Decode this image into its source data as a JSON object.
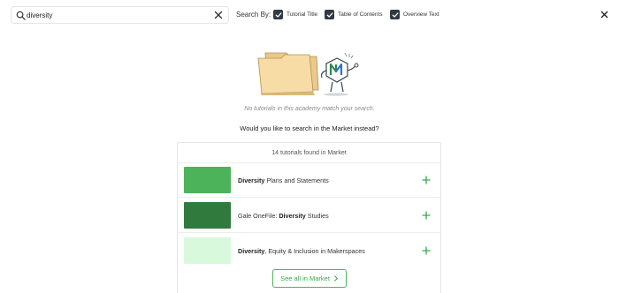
{
  "search": {
    "value": "diversity",
    "placeholder": "",
    "search_by_label": "Search By:",
    "filters": [
      {
        "label": "Tutorial Title",
        "checked": true
      },
      {
        "label": "Table of Contents",
        "checked": true
      },
      {
        "label": "Overview Text",
        "checked": true
      }
    ]
  },
  "icons": {
    "search": "search-icon",
    "clear": "close-icon",
    "close": "close-icon",
    "checkbox": "check-icon",
    "add": "plus-icon",
    "chevron": "chevron-right-icon",
    "illustration": "empty-folder-illustration"
  },
  "empty_state": {
    "message": "No tutorials in this academy match your search.",
    "question": "Would you like to search in the Market instead?"
  },
  "market": {
    "header": "14 tutorials found in Market",
    "results": [
      {
        "prefix": "",
        "bold": "Diversity",
        "suffix": " Plans and Statements",
        "thumb_color": "#4cb35a"
      },
      {
        "prefix": "Gale OneFile: ",
        "bold": "Diversity",
        "suffix": " Studies",
        "thumb_color": "#2f7a3c"
      },
      {
        "prefix": "",
        "bold": "Diversity",
        "suffix": ", Equity & Inclusion in Makerspaces",
        "thumb_color": "#d9f9dc"
      }
    ],
    "see_all_label": "See all in Market"
  },
  "colors": {
    "accent": "#3aa84c",
    "checkbox": "#2f3a44",
    "border": "#e4e4e4"
  }
}
